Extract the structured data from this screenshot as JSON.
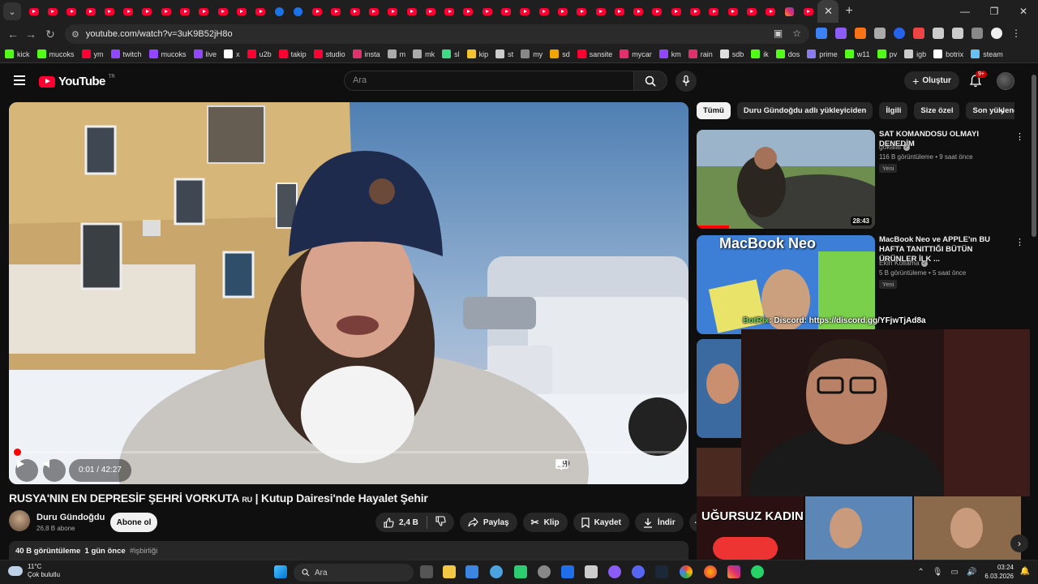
{
  "browser": {
    "url": "youtube.com/watch?v=3uK9B52jH8o",
    "bookmarks": [
      {
        "label": "kick",
        "color": "#53fc18"
      },
      {
        "label": "mucoks",
        "color": "#53fc18"
      },
      {
        "label": "ym",
        "color": "#ff0033"
      },
      {
        "label": "twitch",
        "color": "#9146ff"
      },
      {
        "label": "mucoks",
        "color": "#9146ff"
      },
      {
        "label": "live",
        "color": "#9146ff"
      },
      {
        "label": "x",
        "color": "#ffffff"
      },
      {
        "label": "u2b",
        "color": "#ff0033"
      },
      {
        "label": "takip",
        "color": "#ff0033"
      },
      {
        "label": "studio",
        "color": "#ff0033"
      },
      {
        "label": "insta",
        "color": "#e1306c"
      },
      {
        "label": "m",
        "color": "#aaaaaa"
      },
      {
        "label": "mk",
        "color": "#aaaaaa"
      },
      {
        "label": "sl",
        "color": "#3ddc84"
      },
      {
        "label": "kip",
        "color": "#f4c430"
      },
      {
        "label": "st",
        "color": "#cccccc"
      },
      {
        "label": "my",
        "color": "#888888"
      },
      {
        "label": "sd",
        "color": "#f0a500"
      },
      {
        "label": "sansite",
        "color": "#ff0033"
      },
      {
        "label": "mycar",
        "color": "#e1306c"
      },
      {
        "label": "km",
        "color": "#9146ff"
      },
      {
        "label": "rain",
        "color": "#e1306c"
      },
      {
        "label": "sdb",
        "color": "#dddddd"
      },
      {
        "label": "ik",
        "color": "#53fc18"
      },
      {
        "label": "dos",
        "color": "#53fc18"
      },
      {
        "label": "prime",
        "color": "#8a7cf0"
      },
      {
        "label": "w11",
        "color": "#53fc18"
      },
      {
        "label": "pv",
        "color": "#53fc18"
      },
      {
        "label": "igb",
        "color": "#cccccc"
      },
      {
        "label": "botrix",
        "color": "#ffffff"
      },
      {
        "label": "steam",
        "color": "#66c0f4"
      }
    ]
  },
  "header": {
    "logo_text": "YouTube",
    "logo_region": "TR",
    "search_placeholder": "Ara",
    "create_label": "Oluştur",
    "notif_badge": "9+"
  },
  "player": {
    "time": "0:01 / 42:27",
    "progress_fraction": 0.0004
  },
  "video": {
    "title": "RUSYA'NIN EN DEPRESİF ŞEHRİ VORKUTA",
    "title_flag": "RU",
    "title_rest": " | Kutup Dairesi'nde Hayalet Şehir",
    "channel": "Duru Gündoğdu",
    "subscribers": "26,8 B abone",
    "subscribe_label": "Abone ol",
    "likes": "2,4 B",
    "share_label": "Paylaş",
    "clip_label": "Klip",
    "save_label": "Kaydet",
    "download_label": "İndir",
    "views": "40 B görüntüleme",
    "date": "1 gün önce",
    "hashtag": "#işbirliği"
  },
  "chips": [
    "Tümü",
    "Duru Gündoğdu adlı yükleyiciden",
    "İlgili",
    "Size özel",
    "Son yüklenen"
  ],
  "recommendations": [
    {
      "title": "SAT KOMANDOSU OLMAYI DENEDİM",
      "channel": "gokalaf",
      "meta": "116 B görüntüleme • 9 saat önce",
      "badge": "Yeni",
      "duration": "28:43"
    },
    {
      "title": "MacBook Neo ve APPLE'ın BU HAFTA TANITTIĞI BÜTÜN ÜRÜNLER İLK ...",
      "channel": "Ekin Kollama",
      "meta": "5 B görüntüleme • 5 saat önce",
      "badge": "Yeni",
      "thumb_text": "MacBook Neo"
    }
  ],
  "overlay": {
    "bot_name": "BotRix",
    "discord_text": ": Discord: https://discord.gg/YFjwTjAd8a",
    "thumb_text": "UĞURSUZ KADIN!"
  },
  "taskbar": {
    "temperature": "11°C",
    "weather": "Çok bulutlu",
    "search_label": "Ara",
    "time": "03:24",
    "date": "6.03.2026"
  }
}
